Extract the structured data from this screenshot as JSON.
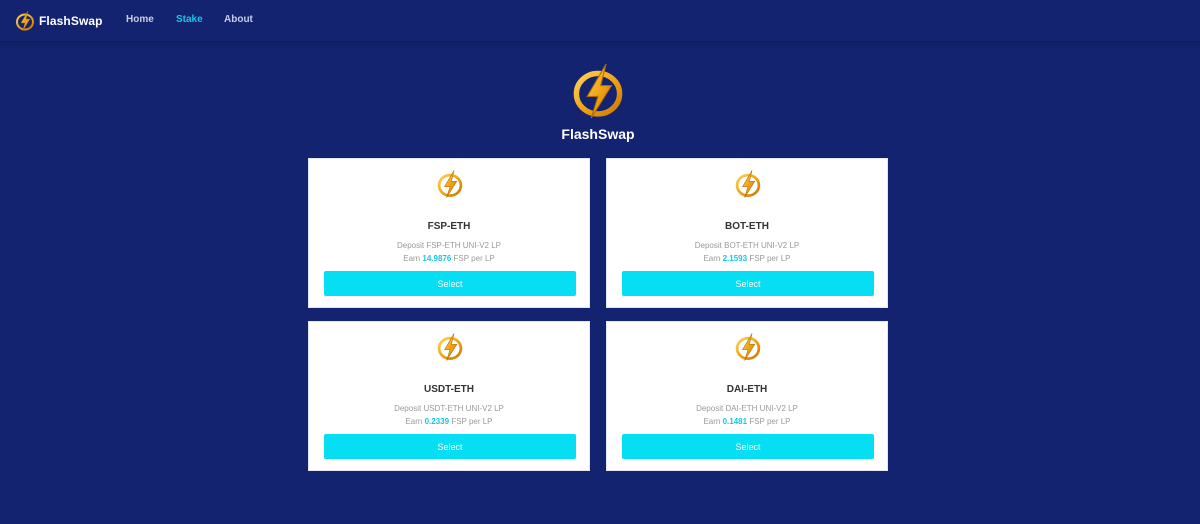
{
  "brand": {
    "name": "FlashSwap",
    "icon": "lightning-coin-icon",
    "accent": "#e6a21a"
  },
  "nav": {
    "items": [
      {
        "label": "Home",
        "active": false
      },
      {
        "label": "Stake",
        "active": true
      },
      {
        "label": "About",
        "active": false
      }
    ],
    "active_color": "#12c8e6"
  },
  "hero": {
    "title": "FlashSwap",
    "icon": "lightning-coin-icon"
  },
  "pools": [
    {
      "name": "FSP-ETH",
      "deposit_prefix": "Deposit",
      "deposit_token": "FSP-ETH UNI-V2 LP",
      "earn_prefix": "Earn",
      "rate": "14.9876",
      "earn_suffix": "FSP per LP",
      "button": "Select"
    },
    {
      "name": "BOT-ETH",
      "deposit_prefix": "Deposit",
      "deposit_token": "BOT-ETH UNI-V2 LP",
      "earn_prefix": "Earn",
      "rate": "2.1593",
      "earn_suffix": "FSP per LP",
      "button": "Select"
    },
    {
      "name": "USDT-ETH",
      "deposit_prefix": "Deposit",
      "deposit_token": "USDT-ETH UNI-V2 LP",
      "earn_prefix": "Earn",
      "rate": "0.2339",
      "earn_suffix": "FSP per LP",
      "button": "Select"
    },
    {
      "name": "DAI-ETH",
      "deposit_prefix": "Deposit",
      "deposit_token": "DAI-ETH UNI-V2 LP",
      "earn_prefix": "Earn",
      "rate": "0.1481",
      "earn_suffix": "FSP per LP",
      "button": "Select"
    }
  ],
  "colors": {
    "background": "#13236f",
    "button": "#05def3",
    "rate": "#12c8e6"
  }
}
